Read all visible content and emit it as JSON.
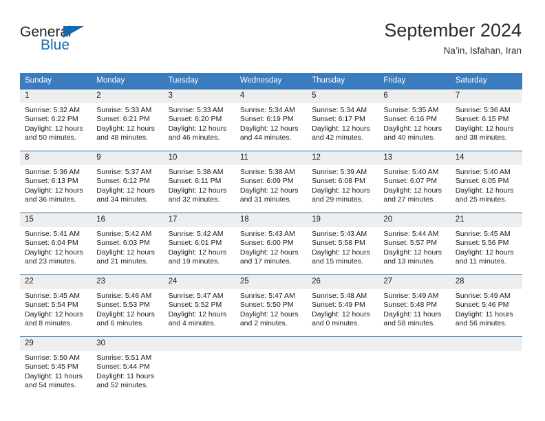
{
  "brand": {
    "name_top": "General",
    "name_bottom": "Blue",
    "accent_color": "#1569b0",
    "flag_icon": "triangle-flag-icon"
  },
  "header": {
    "title": "September 2024",
    "location": "Na’in, Isfahan, Iran"
  },
  "calendar": {
    "header_bg": "#3a7cbe",
    "row_border_color": "#1565a8",
    "daynum_bg": "#eeeeee",
    "weekdays": [
      "Sunday",
      "Monday",
      "Tuesday",
      "Wednesday",
      "Thursday",
      "Friday",
      "Saturday"
    ],
    "weeks": [
      [
        {
          "day": "1",
          "sunrise": "Sunrise: 5:32 AM",
          "sunset": "Sunset: 6:22 PM",
          "daylight1": "Daylight: 12 hours",
          "daylight2": "and 50 minutes."
        },
        {
          "day": "2",
          "sunrise": "Sunrise: 5:33 AM",
          "sunset": "Sunset: 6:21 PM",
          "daylight1": "Daylight: 12 hours",
          "daylight2": "and 48 minutes."
        },
        {
          "day": "3",
          "sunrise": "Sunrise: 5:33 AM",
          "sunset": "Sunset: 6:20 PM",
          "daylight1": "Daylight: 12 hours",
          "daylight2": "and 46 minutes."
        },
        {
          "day": "4",
          "sunrise": "Sunrise: 5:34 AM",
          "sunset": "Sunset: 6:19 PM",
          "daylight1": "Daylight: 12 hours",
          "daylight2": "and 44 minutes."
        },
        {
          "day": "5",
          "sunrise": "Sunrise: 5:34 AM",
          "sunset": "Sunset: 6:17 PM",
          "daylight1": "Daylight: 12 hours",
          "daylight2": "and 42 minutes."
        },
        {
          "day": "6",
          "sunrise": "Sunrise: 5:35 AM",
          "sunset": "Sunset: 6:16 PM",
          "daylight1": "Daylight: 12 hours",
          "daylight2": "and 40 minutes."
        },
        {
          "day": "7",
          "sunrise": "Sunrise: 5:36 AM",
          "sunset": "Sunset: 6:15 PM",
          "daylight1": "Daylight: 12 hours",
          "daylight2": "and 38 minutes."
        }
      ],
      [
        {
          "day": "8",
          "sunrise": "Sunrise: 5:36 AM",
          "sunset": "Sunset: 6:13 PM",
          "daylight1": "Daylight: 12 hours",
          "daylight2": "and 36 minutes."
        },
        {
          "day": "9",
          "sunrise": "Sunrise: 5:37 AM",
          "sunset": "Sunset: 6:12 PM",
          "daylight1": "Daylight: 12 hours",
          "daylight2": "and 34 minutes."
        },
        {
          "day": "10",
          "sunrise": "Sunrise: 5:38 AM",
          "sunset": "Sunset: 6:11 PM",
          "daylight1": "Daylight: 12 hours",
          "daylight2": "and 32 minutes."
        },
        {
          "day": "11",
          "sunrise": "Sunrise: 5:38 AM",
          "sunset": "Sunset: 6:09 PM",
          "daylight1": "Daylight: 12 hours",
          "daylight2": "and 31 minutes."
        },
        {
          "day": "12",
          "sunrise": "Sunrise: 5:39 AM",
          "sunset": "Sunset: 6:08 PM",
          "daylight1": "Daylight: 12 hours",
          "daylight2": "and 29 minutes."
        },
        {
          "day": "13",
          "sunrise": "Sunrise: 5:40 AM",
          "sunset": "Sunset: 6:07 PM",
          "daylight1": "Daylight: 12 hours",
          "daylight2": "and 27 minutes."
        },
        {
          "day": "14",
          "sunrise": "Sunrise: 5:40 AM",
          "sunset": "Sunset: 6:05 PM",
          "daylight1": "Daylight: 12 hours",
          "daylight2": "and 25 minutes."
        }
      ],
      [
        {
          "day": "15",
          "sunrise": "Sunrise: 5:41 AM",
          "sunset": "Sunset: 6:04 PM",
          "daylight1": "Daylight: 12 hours",
          "daylight2": "and 23 minutes."
        },
        {
          "day": "16",
          "sunrise": "Sunrise: 5:42 AM",
          "sunset": "Sunset: 6:03 PM",
          "daylight1": "Daylight: 12 hours",
          "daylight2": "and 21 minutes."
        },
        {
          "day": "17",
          "sunrise": "Sunrise: 5:42 AM",
          "sunset": "Sunset: 6:01 PM",
          "daylight1": "Daylight: 12 hours",
          "daylight2": "and 19 minutes."
        },
        {
          "day": "18",
          "sunrise": "Sunrise: 5:43 AM",
          "sunset": "Sunset: 6:00 PM",
          "daylight1": "Daylight: 12 hours",
          "daylight2": "and 17 minutes."
        },
        {
          "day": "19",
          "sunrise": "Sunrise: 5:43 AM",
          "sunset": "Sunset: 5:58 PM",
          "daylight1": "Daylight: 12 hours",
          "daylight2": "and 15 minutes."
        },
        {
          "day": "20",
          "sunrise": "Sunrise: 5:44 AM",
          "sunset": "Sunset: 5:57 PM",
          "daylight1": "Daylight: 12 hours",
          "daylight2": "and 13 minutes."
        },
        {
          "day": "21",
          "sunrise": "Sunrise: 5:45 AM",
          "sunset": "Sunset: 5:56 PM",
          "daylight1": "Daylight: 12 hours",
          "daylight2": "and 11 minutes."
        }
      ],
      [
        {
          "day": "22",
          "sunrise": "Sunrise: 5:45 AM",
          "sunset": "Sunset: 5:54 PM",
          "daylight1": "Daylight: 12 hours",
          "daylight2": "and 8 minutes."
        },
        {
          "day": "23",
          "sunrise": "Sunrise: 5:46 AM",
          "sunset": "Sunset: 5:53 PM",
          "daylight1": "Daylight: 12 hours",
          "daylight2": "and 6 minutes."
        },
        {
          "day": "24",
          "sunrise": "Sunrise: 5:47 AM",
          "sunset": "Sunset: 5:52 PM",
          "daylight1": "Daylight: 12 hours",
          "daylight2": "and 4 minutes."
        },
        {
          "day": "25",
          "sunrise": "Sunrise: 5:47 AM",
          "sunset": "Sunset: 5:50 PM",
          "daylight1": "Daylight: 12 hours",
          "daylight2": "and 2 minutes."
        },
        {
          "day": "26",
          "sunrise": "Sunrise: 5:48 AM",
          "sunset": "Sunset: 5:49 PM",
          "daylight1": "Daylight: 12 hours",
          "daylight2": "and 0 minutes."
        },
        {
          "day": "27",
          "sunrise": "Sunrise: 5:49 AM",
          "sunset": "Sunset: 5:48 PM",
          "daylight1": "Daylight: 11 hours",
          "daylight2": "and 58 minutes."
        },
        {
          "day": "28",
          "sunrise": "Sunrise: 5:49 AM",
          "sunset": "Sunset: 5:46 PM",
          "daylight1": "Daylight: 11 hours",
          "daylight2": "and 56 minutes."
        }
      ],
      [
        {
          "day": "29",
          "sunrise": "Sunrise: 5:50 AM",
          "sunset": "Sunset: 5:45 PM",
          "daylight1": "Daylight: 11 hours",
          "daylight2": "and 54 minutes."
        },
        {
          "day": "30",
          "sunrise": "Sunrise: 5:51 AM",
          "sunset": "Sunset: 5:44 PM",
          "daylight1": "Daylight: 11 hours",
          "daylight2": "and 52 minutes."
        },
        {
          "day": "",
          "sunrise": "",
          "sunset": "",
          "daylight1": "",
          "daylight2": ""
        },
        {
          "day": "",
          "sunrise": "",
          "sunset": "",
          "daylight1": "",
          "daylight2": ""
        },
        {
          "day": "",
          "sunrise": "",
          "sunset": "",
          "daylight1": "",
          "daylight2": ""
        },
        {
          "day": "",
          "sunrise": "",
          "sunset": "",
          "daylight1": "",
          "daylight2": ""
        },
        {
          "day": "",
          "sunrise": "",
          "sunset": "",
          "daylight1": "",
          "daylight2": ""
        }
      ]
    ]
  }
}
